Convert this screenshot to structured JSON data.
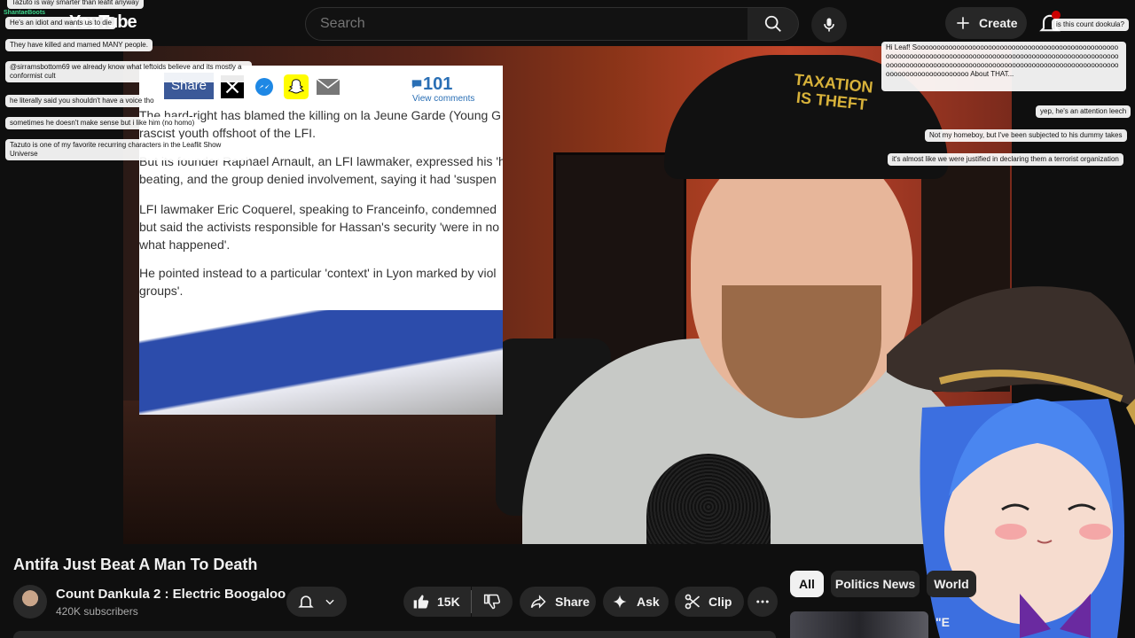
{
  "masthead": {
    "logo_text": "YouTube",
    "search_placeholder": "Search",
    "create_label": "Create"
  },
  "article": {
    "share_label": "Share",
    "comments_count": "101",
    "comments_label": "View comments",
    "paragraphs": [
      "The hard-right has blamed the killing on la Jeune Garde (Young G",
      "rascist youth offshoot of the LFI.",
      "But its founder Raphael Arnault, an LFI lawmaker, expressed his 'h",
      "beating, and the group denied involvement, saying it had 'suspen",
      "LFI lawmaker Eric Coquerel, speaking to Franceinfo, condemned",
      "but said the activists responsible for Hassan's security 'were in no",
      "what happened'.",
      "He pointed instead to a particular 'context' in Lyon marked by viol",
      "groups'."
    ]
  },
  "video_overlay": {
    "cap_text_1": "TAXATION",
    "cap_text_2": "IS THEFT"
  },
  "chat_left": [
    {
      "name": "",
      "text": "Tazuto is way smarter than leafit anyway"
    },
    {
      "name": "ShantaeBoots",
      "text": "He's an idiot and wants us to die"
    },
    {
      "name": "",
      "text": "They have killed and mamed MANY people."
    },
    {
      "name": "",
      "text": "@sirramsbottom69 we already know what leftoids believe and its mostly a conformist cult"
    },
    {
      "name": "",
      "text": "he literally said you shouldn't have a voice tho"
    },
    {
      "name": "",
      "text": "sometimes he doesn't make sense but i like him (no homo)"
    },
    {
      "name": "",
      "text": "Tazuto is one of my favorite recurring characters in the Leaflit Show Universe"
    }
  ],
  "chat_right": [
    {
      "text": "is this count dookula?"
    },
    {
      "text": "Hi Leaf! Soooooooooooooooooooooooooooooooooooooooooooooooooooooooooooooooooooooooooooooooooooooooooooooooooooooooooooooooooooooooooooooooooooooooooooooooooooooooooooooooooooooooooooooooooooooooooooooo About THAT..."
    },
    {
      "text": "yep, he's an attention leech"
    },
    {
      "text": "Not my homeboy, but I've been subjected to his dummy takes"
    },
    {
      "text": "it's almost like we were justified in declaring them a terrorist organization"
    }
  ],
  "video": {
    "title": "Antifa Just Beat A Man To Death",
    "channel_name": "Count Dankula 2 : Electric Boogaloo",
    "subscribers": "420K subscribers",
    "likes": "15K",
    "share_label": "Share",
    "ask_label": "Ask",
    "clip_label": "Clip"
  },
  "chips": [
    "All",
    "Politics News",
    "World"
  ],
  "recommendation": {
    "title_partial": "\"E"
  }
}
